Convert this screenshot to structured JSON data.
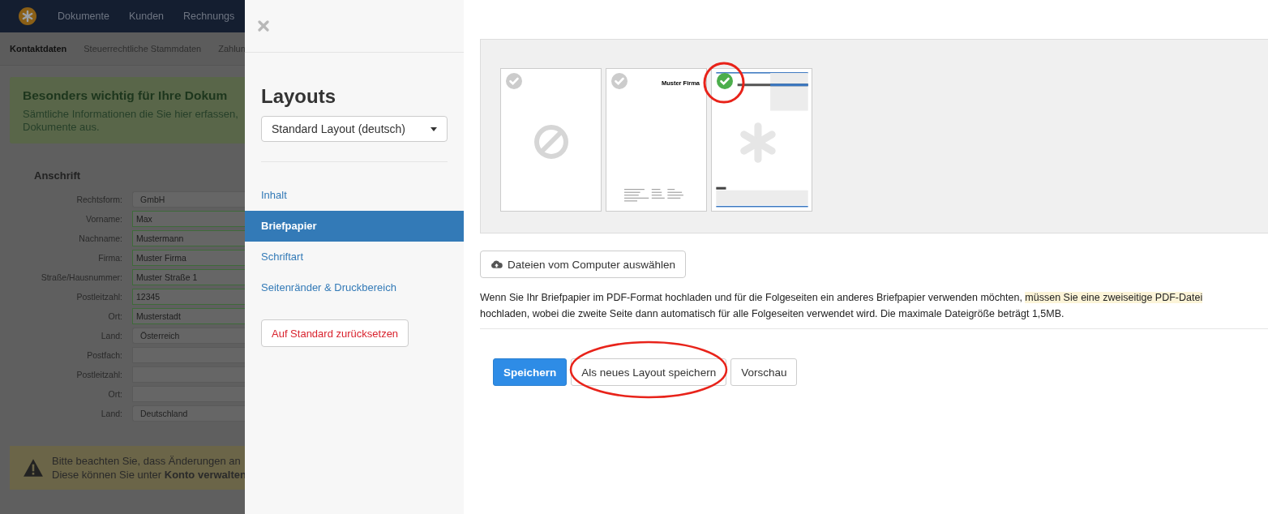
{
  "background_page": {
    "nav": [
      "Dokumente",
      "Kunden",
      "Rechnungs"
    ],
    "subnav": [
      {
        "label": "Kontaktdaten",
        "selected": true
      },
      {
        "label": "Steuerrechtliche Stammdaten",
        "selected": false
      },
      {
        "label": "Zahlun",
        "selected": false
      }
    ],
    "notice": {
      "title": "Besonders wichtig für Ihre Dokum",
      "lines": [
        "Sämtliche Informationen die Sie hier erfassen,",
        "Dokumente aus."
      ]
    },
    "section_title": "Anschrift",
    "fields": [
      {
        "label": "Rechtsform:",
        "value": "GmbH",
        "kind": "select"
      },
      {
        "label": "Vorname:",
        "value": "Max",
        "kind": "valid"
      },
      {
        "label": "Nachname:",
        "value": "Mustermann",
        "kind": "valid"
      },
      {
        "label": "Firma:",
        "value": "Muster Firma",
        "kind": "valid"
      },
      {
        "label": "Straße/Hausnummer:",
        "value": "Muster Straße 1",
        "kind": "valid"
      },
      {
        "label": "Postleitzahl:",
        "value": "12345",
        "kind": "valid"
      },
      {
        "label": "Ort:",
        "value": "Musterstadt",
        "kind": "valid"
      },
      {
        "label": "Land:",
        "value": "Österreich",
        "kind": "select"
      },
      {
        "label": "Postfach:",
        "kind": "input"
      },
      {
        "label": "Postleitzahl:",
        "kind": "input"
      },
      {
        "label": "Ort:",
        "kind": "input"
      },
      {
        "label": "Land:",
        "value": "Deutschland",
        "kind": "select"
      }
    ],
    "warning": [
      "Bitte beachten Sie, dass Änderungen an",
      "Diese können Sie unter **Konto verwalten**"
    ]
  },
  "panel": {
    "title": "Layouts",
    "layout_select": "Standard Layout (deutsch)",
    "menu": [
      {
        "label": "Inhalt",
        "selected": false
      },
      {
        "label": "Briefpapier",
        "selected": true
      },
      {
        "label": "Schriftart",
        "selected": false
      },
      {
        "label": "Seitenränder & Druckbereich",
        "selected": false
      }
    ],
    "reset_button": "Auf Standard zurücksetzen"
  },
  "letterheads": [
    {
      "kind": "empty",
      "selected": false
    },
    {
      "kind": "company",
      "selected": false,
      "company": "Muster Firma"
    },
    {
      "kind": "logo",
      "selected": true
    }
  ],
  "upload_button": "Dateien vom Computer auswählen",
  "hint": {
    "before": "Wenn Sie Ihr Briefpapier im PDF-Format hochladen und für die Folgeseiten ein anderes Briefpapier verwenden möchten, ",
    "highlight": "müssen Sie eine zweiseitige PDF-Datei",
    "after": " hochladen, wobei die zweite Seite dann automatisch für alle Folgeseiten verwendet wird. Die maximale Dateigröße beträgt 1,5MB."
  },
  "buttons": [
    {
      "label": "Speichern",
      "kind": "primary"
    },
    {
      "label": "Als neues Layout speichern",
      "kind": "default"
    },
    {
      "label": "Vorschau",
      "kind": "default"
    }
  ]
}
